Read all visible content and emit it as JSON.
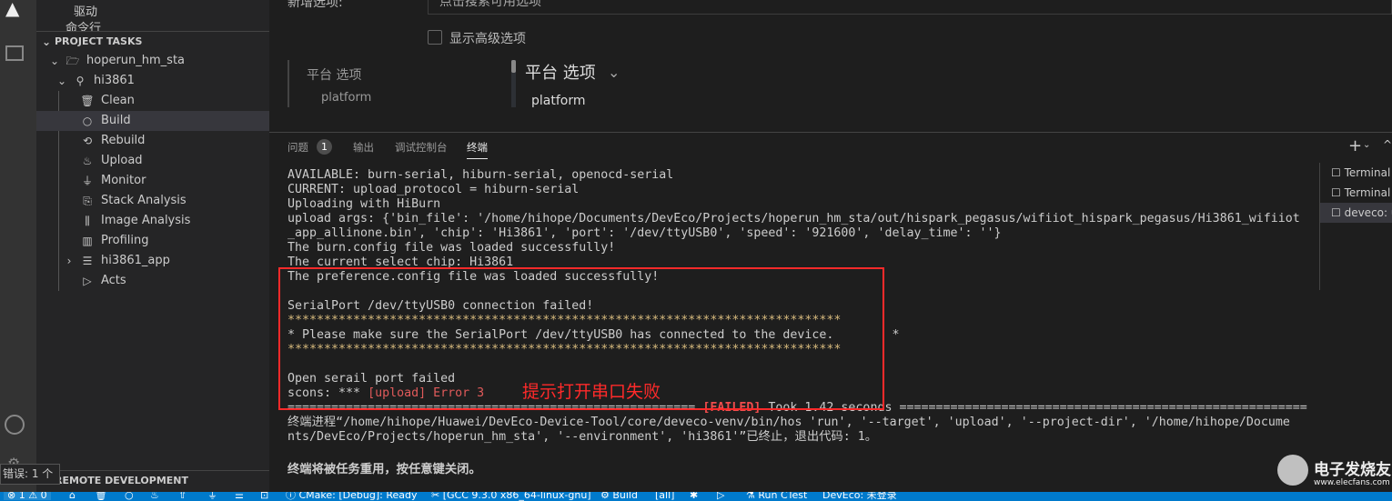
{
  "sidebar": {
    "top_item": "驱动",
    "partial_item": "命令行",
    "section": "PROJECT TASKS",
    "project": "hoperun_hm_sta",
    "device": "hi3861",
    "tasks": [
      {
        "label": "Clean",
        "icon": "trash-icon"
      },
      {
        "label": "Build",
        "icon": "circle-icon"
      },
      {
        "label": "Rebuild",
        "icon": "rebuild-icon"
      },
      {
        "label": "Upload",
        "icon": "flame-icon"
      },
      {
        "label": "Monitor",
        "icon": "plug-icon"
      },
      {
        "label": "Stack Analysis",
        "icon": "stack-analysis-icon"
      },
      {
        "label": "Image Analysis",
        "icon": "image-analysis-icon"
      },
      {
        "label": "Profiling",
        "icon": "bar-chart-icon"
      },
      {
        "label": "hi3861_app",
        "icon": "server-icon"
      },
      {
        "label": "Acts",
        "icon": "play-icon"
      }
    ],
    "remote": "REMOTE DEVELOPMENT",
    "tooltip": "错误: 1 个"
  },
  "editor": {
    "add_option_label": "新增选项:",
    "search_placeholder": "点击搜索可用选项",
    "advanced_label": "显示高级选项",
    "left_title": "平台 选项",
    "left_sub": "platform",
    "right_title": "平台 选项",
    "right_sub": "platform"
  },
  "panel": {
    "tabs": [
      "问题",
      "输出",
      "调试控制台",
      "终端"
    ],
    "problems_count": "1",
    "active_tab": "终端",
    "terminals": [
      "Terminal",
      "Terminal",
      "deveco: u"
    ],
    "lines": [
      "AVAILABLE: burn-serial, hiburn-serial, openocd-serial",
      "CURRENT: upload_protocol = hiburn-serial",
      "Uploading with HiBurn",
      "upload args: {'bin_file': '/home/hihope/Documents/DevEco/Projects/hoperun_hm_sta/out/hispark_pegasus/wifiiot_hispark_pegasus/Hi3861_wifiiot",
      "_app_allinone.bin', 'chip': 'Hi3861', 'port': '/dev/ttyUSB0', 'speed': '921600', 'delay_time': ''}",
      "The burn.config file was loaded successfully!",
      "The current select chip: Hi3861",
      "The preference.config file was loaded successfully!",
      "",
      "SerialPort /dev/ttyUSB0 connection failed!",
      "****************************************************************************",
      "* Please make sure the SerialPort /dev/ttyUSB0 has connected to the device.        *",
      "****************************************************************************",
      "",
      "Open serail port failed"
    ],
    "error_prefix": "scons: *** ",
    "error_text": "[upload] Error 3",
    "failed_pre": "======================================================== ",
    "failed_tag": "[FAILED]",
    "failed_post": " Took 1.42 seconds ========================================================",
    "exit_line1": "终端进程“/home/hihope/Huawei/DevEco-Device-Tool/core/deveco-venv/bin/hos 'run', '--target', 'upload', '--project-dir', '/home/hihope/Docume",
    "exit_line2": "nts/DevEco/Projects/hoperun_hm_sta', '--environment', 'hi3861'”已终止，退出代码: 1。",
    "reuse_line": "终端将被任务重用，按任意键关闭。",
    "annotation": "提示打开串口失败",
    "annotation_color": "#ff2a2a"
  },
  "statusbar": {
    "errors": "1",
    "warnings": "0",
    "cmake": "CMake: [Debug]: Ready",
    "kit": "[GCC 9.3.0 x86_64-linux-gnu]",
    "build": "Build",
    "target": "[all]",
    "ctest": "Run CTest",
    "deveco": "DevEco: 未登录",
    "color": "#007acc"
  },
  "watermark": {
    "text": "电子发烧友",
    "url": "www.elecfans.com"
  }
}
